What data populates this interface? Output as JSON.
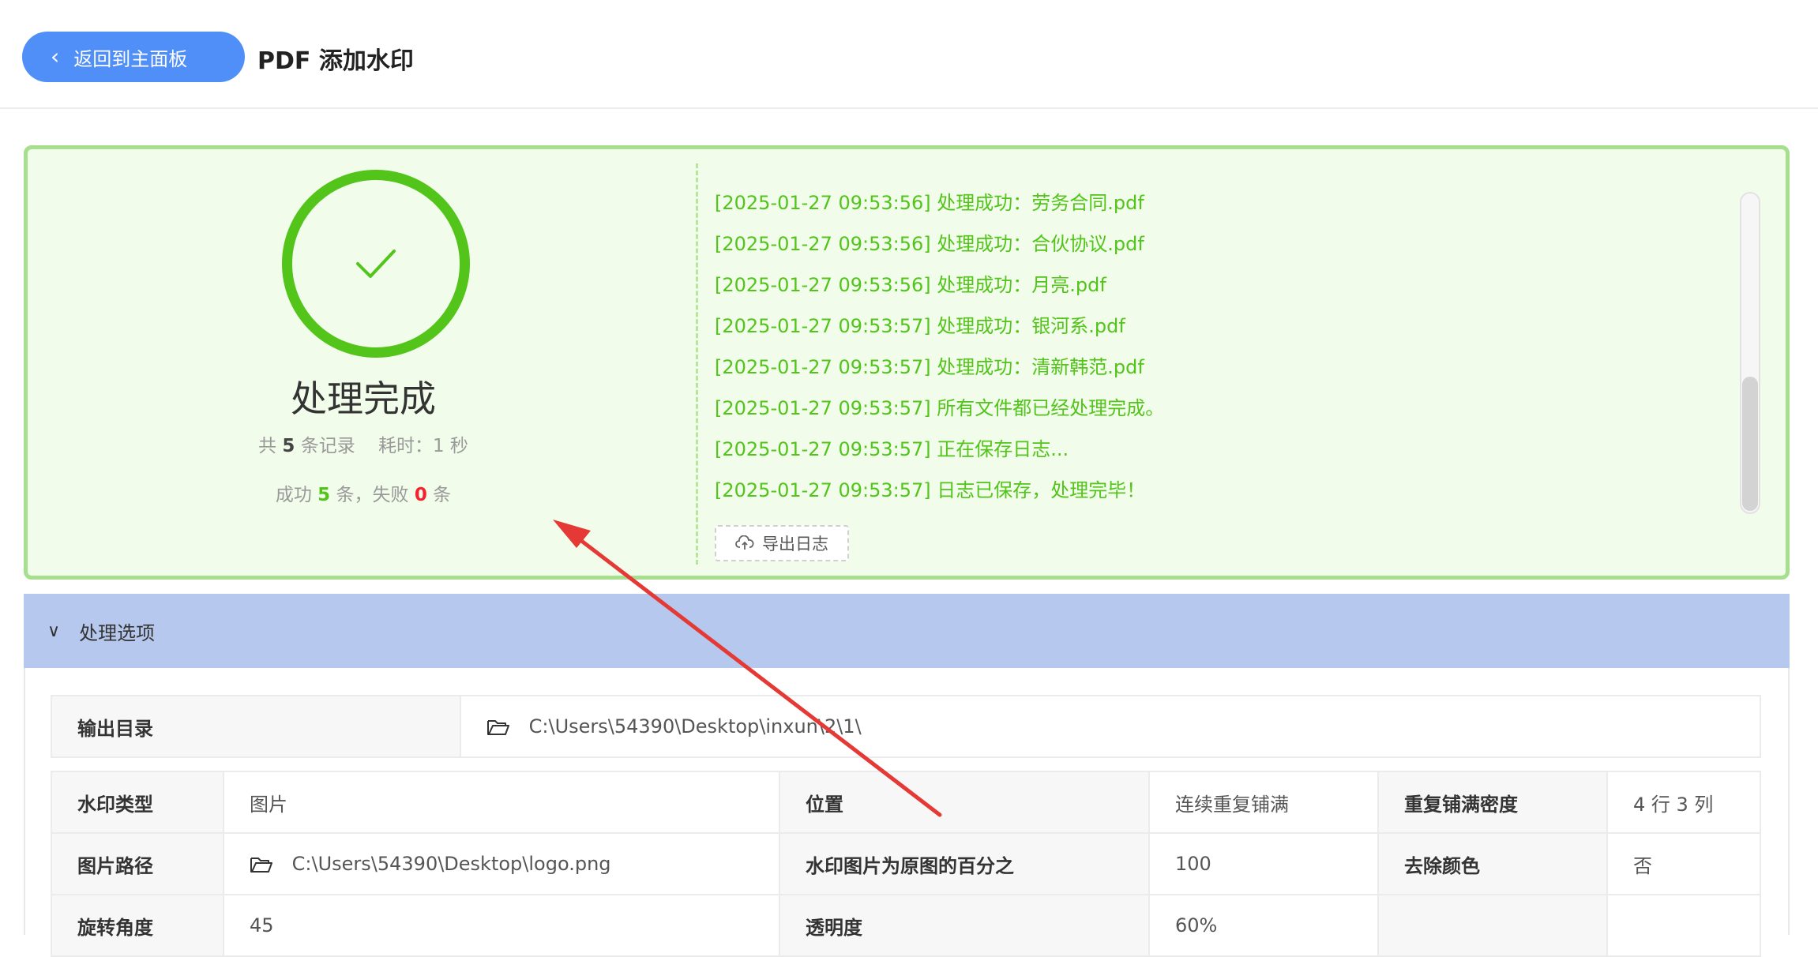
{
  "header": {
    "back_label": "返回到主面板",
    "title": "PDF 添加水印"
  },
  "result": {
    "status": "处理完成",
    "total_prefix": "共",
    "total_count": "5",
    "total_unit": "条记录",
    "elapsed_label": "耗时：1 秒",
    "success_prefix": "成功",
    "success_count": "5",
    "success_mid": "条，失败",
    "fail_count": "0",
    "fail_suffix": "条",
    "logs": [
      "[2025-01-27 09:53:56] 处理成功：劳务合同.pdf",
      "[2025-01-27 09:53:56] 处理成功：合伙协议.pdf",
      "[2025-01-27 09:53:56] 处理成功：月亮.pdf",
      "[2025-01-27 09:53:57] 处理成功：银河系.pdf",
      "[2025-01-27 09:53:57] 处理成功：清新韩范.pdf",
      "[2025-01-27 09:53:57] 所有文件都已经处理完成。",
      "[2025-01-27 09:53:57] 正在保存日志...",
      "[2025-01-27 09:53:57] 日志已保存，处理完毕！"
    ],
    "export_label": "导出日志",
    "success_color": "#52c41a",
    "fail_color": "#f5222d"
  },
  "options": {
    "section_label": "处理选项",
    "output_dir_label": "输出目录",
    "output_dir_value": "C:\\Users\\54390\\Desktop\\inxun\\2\\1\\",
    "rows": [
      [
        "水印类型",
        "图片",
        "位置",
        "连续重复铺满",
        "重复铺满密度",
        "4 行 3 列"
      ],
      [
        "图片路径",
        "C:\\Users\\54390\\Desktop\\logo.png",
        "水印图片为原图的百分之",
        "100",
        "去除颜色",
        "否"
      ],
      [
        "旋转角度",
        "45",
        "透明度",
        "60%",
        "",
        ""
      ]
    ]
  }
}
